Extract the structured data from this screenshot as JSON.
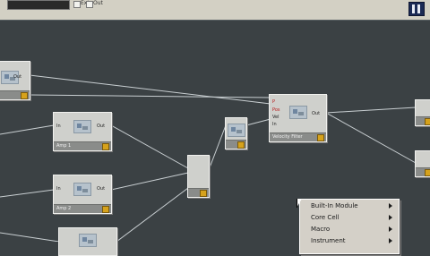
{
  "toolbar": {
    "checkbox_1_label": "Ext",
    "checkbox_2_label": "Out"
  },
  "modules": {
    "left_top": {
      "port_out": "Out"
    },
    "amp1": {
      "name": "Amp 1",
      "port_in": "In",
      "port_out": "Out"
    },
    "amp2": {
      "name": "Amp 2",
      "port_in": "In",
      "port_out": "Out"
    },
    "filter": {
      "name": "Velocity Filter",
      "port_in_1": "P",
      "port_in_2": "Pos",
      "port_in_3": "Vel",
      "port_in_4": "In",
      "port_out": "Out"
    }
  },
  "context_menu": {
    "items": [
      "Built-In Module",
      "Core Cell",
      "Macro",
      "Instrument"
    ]
  }
}
